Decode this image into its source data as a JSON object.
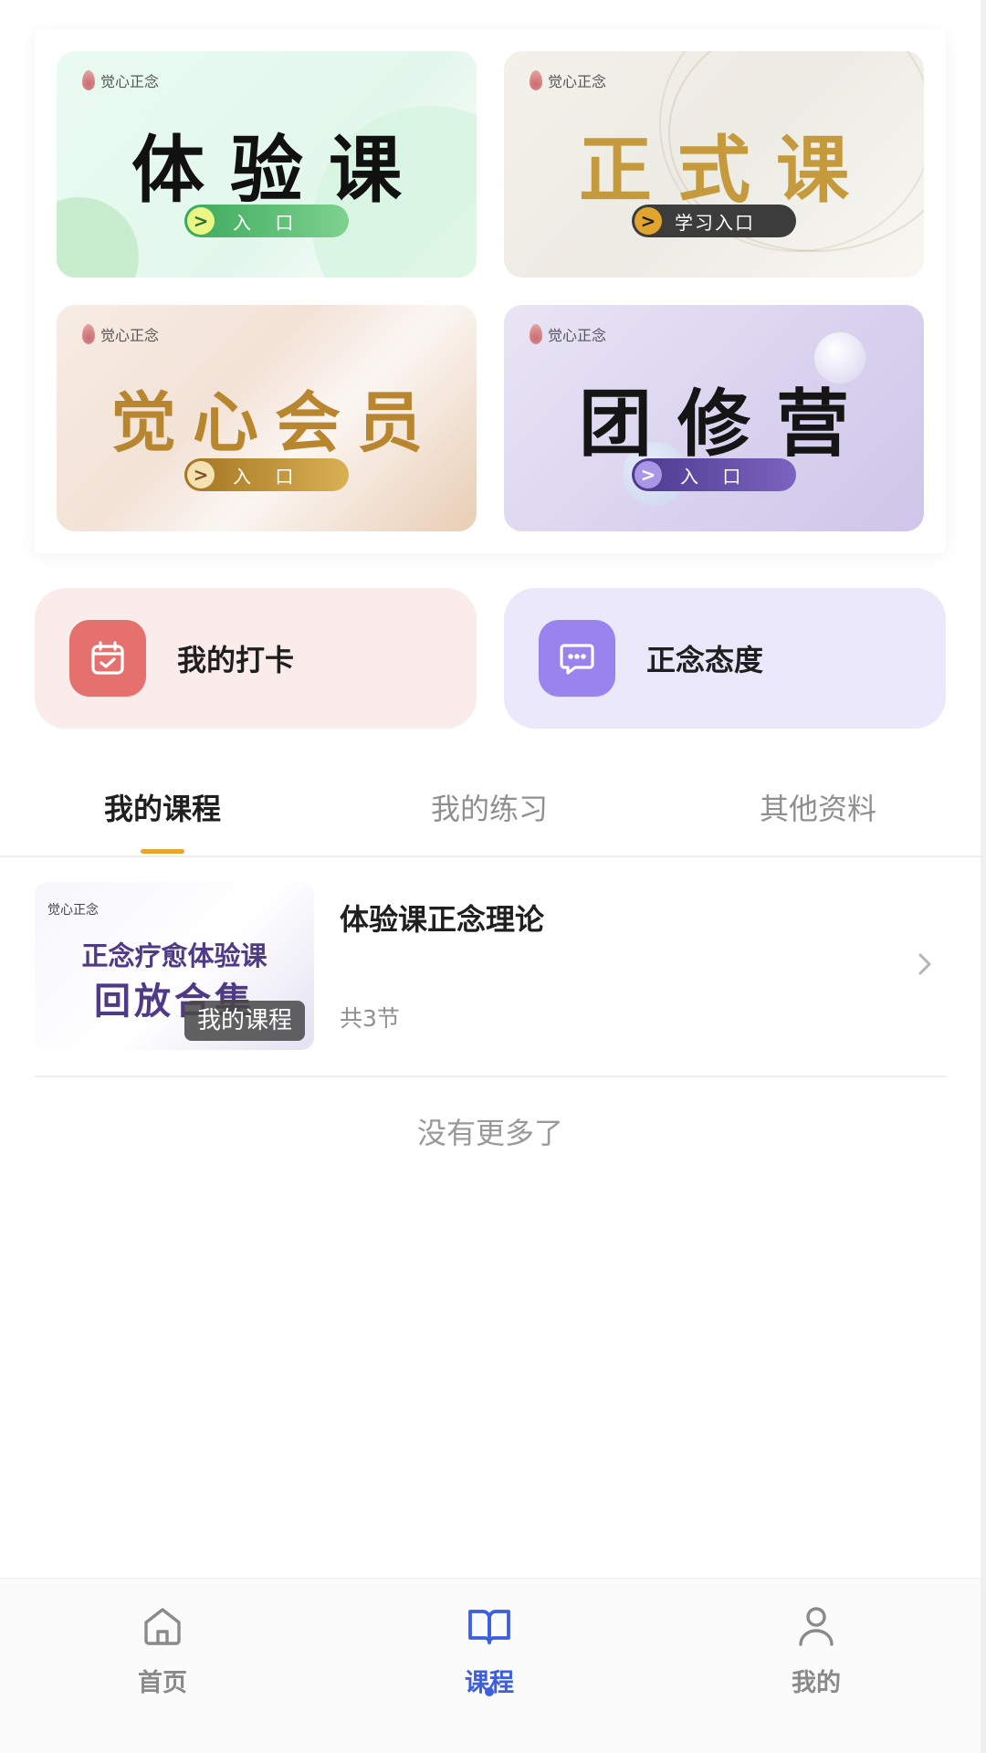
{
  "banners": [
    {
      "brand": "觉心正念",
      "title": "体验课",
      "button": "入 口"
    },
    {
      "brand": "觉心正念",
      "title": "正式课",
      "button": "学习入口"
    },
    {
      "brand": "觉心正念",
      "title": "觉心会员",
      "button": "入 口"
    },
    {
      "brand": "觉心正念",
      "title": "团修营",
      "button": "入 口"
    }
  ],
  "quick_actions": [
    {
      "label": "我的打卡",
      "icon": "calendar-check-icon",
      "color": "#e4716d"
    },
    {
      "label": "正念态度",
      "icon": "chat-bubble-icon",
      "color": "#9a83ec"
    }
  ],
  "tabs": [
    {
      "label": "我的课程",
      "active": true
    },
    {
      "label": "我的练习",
      "active": false
    },
    {
      "label": "其他资料",
      "active": false
    }
  ],
  "course": {
    "thumb_brand": "觉心正念",
    "thumb_line1": "正念疗愈体验课",
    "thumb_line2": "回放合集",
    "badge": "我的课程",
    "title": "体验课正念理论",
    "sections": "共3节"
  },
  "no_more": "没有更多了",
  "bottom_nav": [
    {
      "label": "首页",
      "icon": "home-icon",
      "active": false
    },
    {
      "label": "课程",
      "icon": "book-open-icon",
      "active": true
    },
    {
      "label": "我的",
      "icon": "user-icon",
      "active": false
    }
  ],
  "colors": {
    "accent": "#3b5fe0",
    "tab_underline": "#e9a52b",
    "muted_text": "#8f8f8f"
  }
}
